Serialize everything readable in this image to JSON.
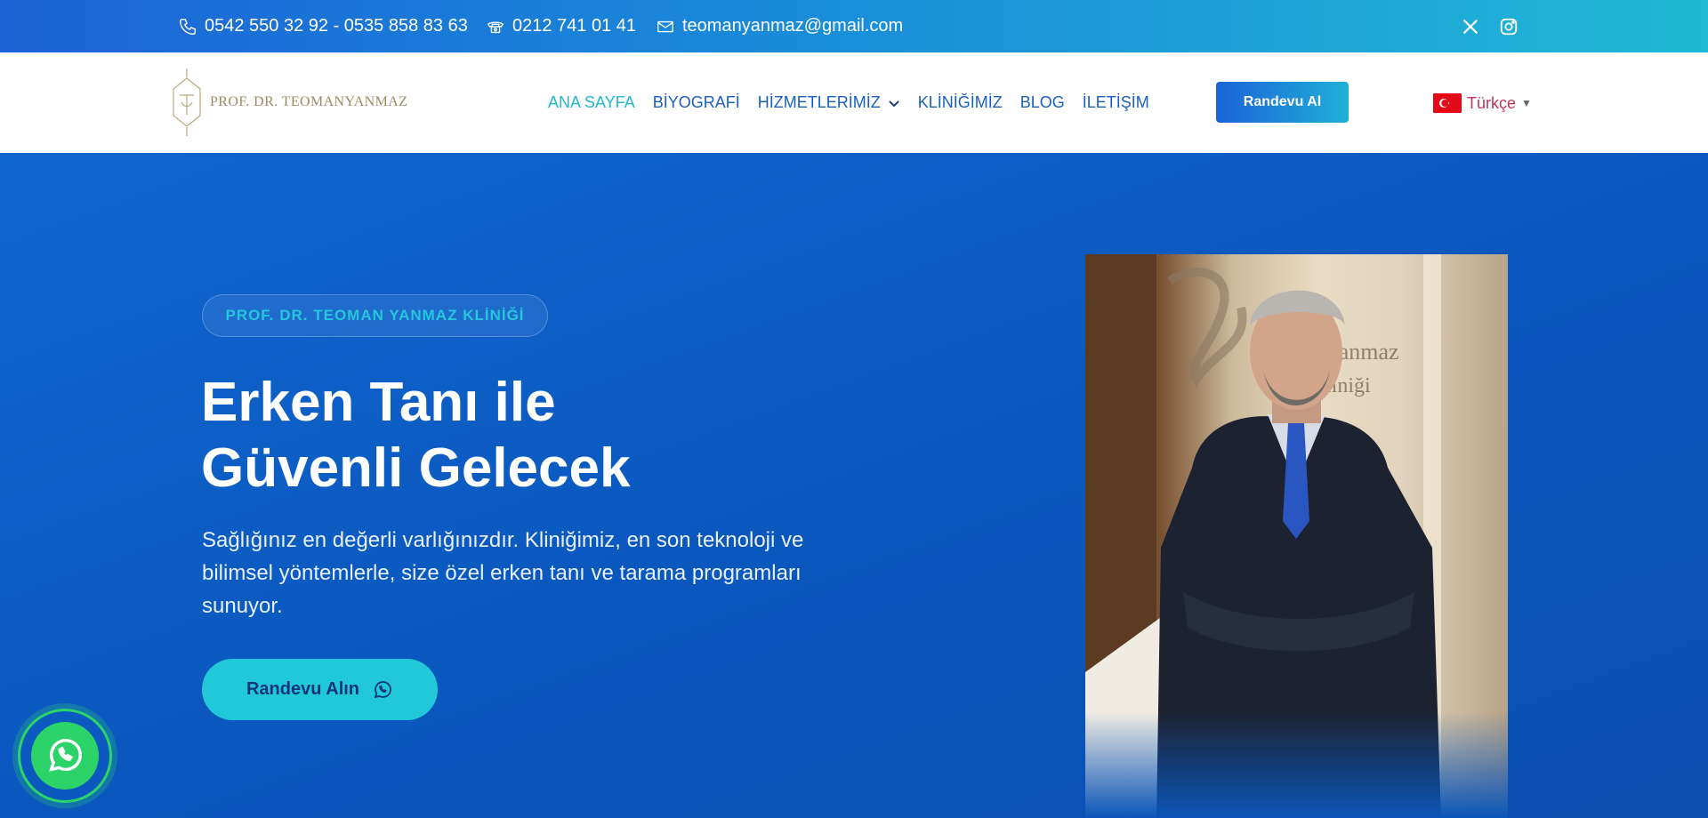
{
  "topbar": {
    "phone_mobile": "0542 550 32 92 - 0535 858 83 63",
    "phone_landline": "0212 741 01 41",
    "email": "teomanyanmaz@gmail.com",
    "social": [
      "x-icon",
      "instagram-icon"
    ]
  },
  "header": {
    "logo_text": "PROF. DR. TEOMANYANMAZ",
    "nav": [
      {
        "label": "ANA SAYFA",
        "active": true
      },
      {
        "label": "BİYOGRAFİ"
      },
      {
        "label": "HİZMETLERİMİZ",
        "has_dropdown": true
      },
      {
        "label": "KLİNİĞİMİZ"
      },
      {
        "label": "BLOG"
      },
      {
        "label": "İLETİŞİM"
      }
    ],
    "cta_label": "Randevu Al",
    "language": "Türkçe"
  },
  "hero": {
    "badge": "PROF. DR. TEOMAN YANMAZ KLİNİĞİ",
    "title_line1": "Erken Tanı ile",
    "title_line2": "Güvenli Gelecek",
    "text": "Sağlığınız en değerli varlığınızdır. Kliniğimiz, en son teknoloji ve bilimsel yöntemlerle, size özel erken tanı ve tarama programları sunuyor.",
    "cta_label": "Randevu Alın"
  },
  "colors": {
    "primary": "#1b5fbf",
    "accent": "#22b8cf",
    "hero_bg": "#0a57bd",
    "whatsapp": "#2bd368"
  }
}
